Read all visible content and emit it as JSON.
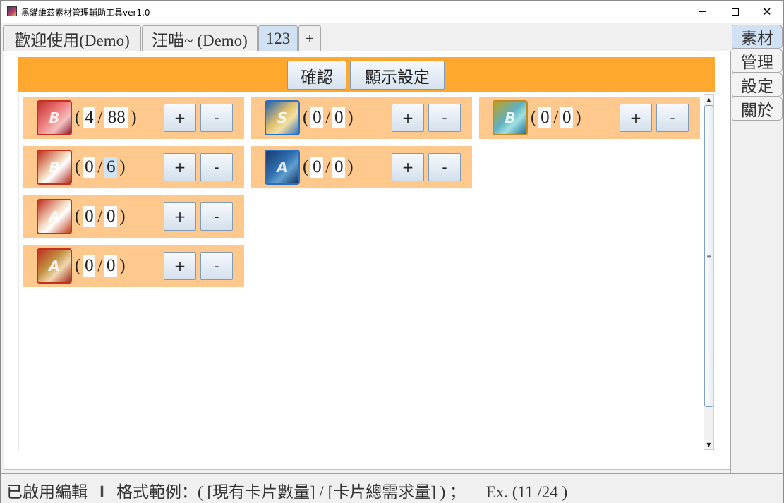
{
  "window": {
    "title": "黑貓維茲素材管理輔助工具ver1.0",
    "minimize": "",
    "maximize": "",
    "close": "✕"
  },
  "tabs": [
    {
      "label": "歡迎使用(Demo)"
    },
    {
      "label": "汪喵~ (Demo)"
    },
    {
      "label": "123"
    },
    {
      "label": "+"
    }
  ],
  "side_tabs": [
    {
      "label": "素材"
    },
    {
      "label": "管理"
    },
    {
      "label": "設定"
    },
    {
      "label": "關於"
    }
  ],
  "toolbar": {
    "confirm_label": "確認",
    "display_settings_label": "顯示設定"
  },
  "cards": [
    {
      "icon": "red-b-character-icon",
      "badge": "B",
      "current": "4",
      "total": "88",
      "sep": "/",
      "open": "(",
      "close": ")",
      "plus": "+",
      "minus": "-"
    },
    {
      "icon": "blue-s-character-icon",
      "badge": "S",
      "current": "0",
      "total": "0",
      "sep": "/",
      "open": "(",
      "close": ")",
      "plus": "+",
      "minus": "-"
    },
    {
      "icon": "gold-b-character-icon",
      "badge": "B",
      "current": "0",
      "total": "0",
      "sep": "/",
      "open": "(",
      "close": ")",
      "plus": "+",
      "minus": "-"
    },
    {
      "icon": "red-b-cat-icon",
      "badge": "B",
      "current": "0",
      "total": "6",
      "sep": "/",
      "open": "(",
      "close": ")",
      "plus": "+",
      "minus": "-"
    },
    {
      "icon": "blue-a-whale-icon",
      "badge": "A",
      "current": "0",
      "total": "0",
      "sep": "/",
      "open": "(",
      "close": ")",
      "plus": "+",
      "minus": "-"
    },
    {
      "icon": "red-a-character-icon",
      "badge": "A",
      "current": "0",
      "total": "0",
      "sep": "/",
      "open": "(",
      "close": ")",
      "plus": "+",
      "minus": "-"
    },
    {
      "icon": "red-a-girl-icon",
      "badge": "A",
      "current": "0",
      "total": "0",
      "sep": "/",
      "open": "(",
      "close": ")",
      "plus": "+",
      "minus": "-"
    }
  ],
  "scrollbar": {
    "up": "▲",
    "down": "▼",
    "grip": "≡"
  },
  "status": {
    "text": "已啟用編輯   ǁ   格式範例：( [現有卡片數量] / [卡片總需求量] ) ；     Ex. (11 /24 )"
  }
}
